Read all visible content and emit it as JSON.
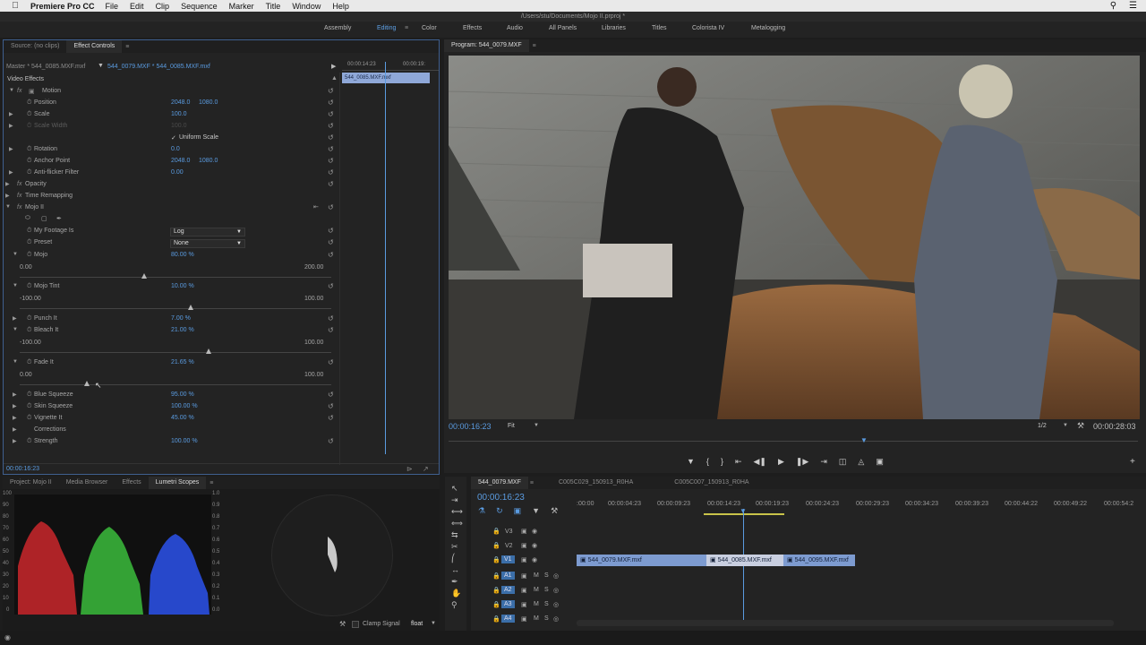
{
  "menubar": {
    "app": "Premiere Pro CC",
    "items": [
      "File",
      "Edit",
      "Clip",
      "Sequence",
      "Marker",
      "Title",
      "Window",
      "Help"
    ]
  },
  "titlebar": {
    "path": "/Users/stu/Documents/Mojo II.prproj *"
  },
  "workspaces": [
    "Assembly",
    "Editing",
    "Color",
    "Effects",
    "Audio",
    "All Panels",
    "Libraries",
    "Titles",
    "Colorista IV",
    "Metalogging"
  ],
  "effect_controls": {
    "tabs": {
      "source": "Source: (no clips)",
      "ec": "Effect Controls"
    },
    "master": "Master * 544_0085.MXF.mxf",
    "clip": "544_0079.MXF * 544_0085.MXF.mxf",
    "time_a": "00:00:14:23",
    "time_b": "00:00:19:",
    "clip_bar": "544_0085.MXF.mxf",
    "section": "Video Effects",
    "motion": "Motion",
    "position": {
      "label": "Position",
      "x": "2048.0",
      "y": "1080.0"
    },
    "scale": {
      "label": "Scale",
      "v": "100.0"
    },
    "scale_width": {
      "label": "Scale Width",
      "v": "100.0"
    },
    "uniform_scale": "Uniform Scale",
    "rotation": {
      "label": "Rotation",
      "v": "0.0"
    },
    "anchor": {
      "label": "Anchor Point",
      "x": "2048.0",
      "y": "1080.0"
    },
    "antiflicker": {
      "label": "Anti-flicker Filter",
      "v": "0.00"
    },
    "opacity": "Opacity",
    "time_remap": "Time Remapping",
    "mojo": "Mojo II",
    "footage": {
      "label": "My Footage Is",
      "v": "Log"
    },
    "preset": {
      "label": "Preset",
      "v": "None"
    },
    "mojo_p": {
      "label": "Mojo",
      "v": "80.00 %",
      "min": "0.00",
      "max": "200.00",
      "pos": 0.4
    },
    "tint": {
      "label": "Mojo Tint",
      "v": "10.00 %",
      "min": "-100.00",
      "max": "100.00",
      "pos": 0.55
    },
    "punch": {
      "label": "Punch It",
      "v": "7.00 %"
    },
    "bleach": {
      "label": "Bleach It",
      "v": "21.00 %",
      "min": "-100.00",
      "max": "100.00",
      "pos": 0.605
    },
    "fade": {
      "label": "Fade It",
      "v": "21.65 %",
      "min": "0.00",
      "max": "100.00",
      "pos": 0.2165
    },
    "blue": {
      "label": "Blue Squeeze",
      "v": "95.00 %"
    },
    "skin": {
      "label": "Skin Squeeze",
      "v": "100.00 %"
    },
    "vignette": {
      "label": "Vignette It",
      "v": "45.00 %"
    },
    "corrections": "Corrections",
    "strength": {
      "label": "Strength",
      "v": "100.00 %"
    },
    "timecode": "00:00:16:23"
  },
  "program": {
    "title": "Program: 544_0079.MXF",
    "time": "00:00:16:23",
    "fit": "Fit",
    "res": "1/2",
    "duration": "00:00:28:03"
  },
  "bottom_left": {
    "tabs": [
      "Project: Mojo II",
      "Media Browser",
      "Effects",
      "Lumetri Scopes"
    ],
    "left_scale": [
      "100",
      "90",
      "80",
      "70",
      "60",
      "50",
      "40",
      "30",
      "20",
      "10",
      "0"
    ],
    "right_scale": [
      "1.0",
      "0.9",
      "0.8",
      "0.7",
      "0.6",
      "0.5",
      "0.4",
      "0.3",
      "0.2",
      "0.1",
      "0.0"
    ],
    "clamp": "Clamp Signal",
    "float": "float"
  },
  "timeline": {
    "tabs": [
      "544_0079.MXF",
      "C005C029_150913_R0HA",
      "C005C007_150913_R0HA"
    ],
    "time": "00:00:16:23",
    "ruler": [
      ":00:00",
      "00:00:04:23",
      "00:00:09:23",
      "00:00:14:23",
      "00:00:19:23",
      "00:00:24:23",
      "00:00:29:23",
      "00:00:34:23",
      "00:00:39:23",
      "00:00:44:22",
      "00:00:49:22",
      "00:00:54:2"
    ],
    "tracks": [
      "V3",
      "V2",
      "V1",
      "A1",
      "A2",
      "A3",
      "A4"
    ],
    "clips": [
      "544_0079.MXF.mxf",
      "544_0085.MXF.mxf",
      "544_0095.MXF.mxf"
    ]
  },
  "colors": {
    "accent": "#5a9be0",
    "panel": "#232323",
    "border": "#3f5f8f"
  }
}
